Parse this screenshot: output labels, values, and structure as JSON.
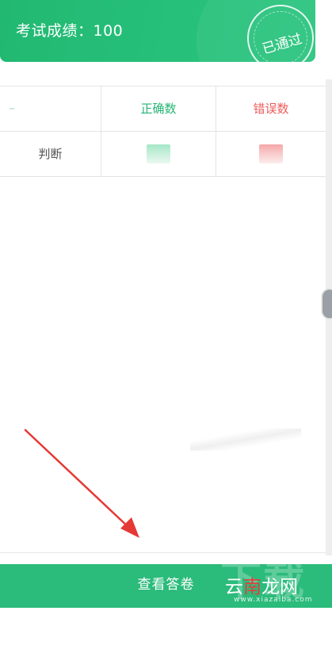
{
  "banner": {
    "score_text": "考试成绩：100",
    "stamp_text": "已通过"
  },
  "table": {
    "headers": [
      "",
      "正确数",
      "错误数"
    ],
    "rows": [
      {
        "type": "判断"
      }
    ]
  },
  "bottom": {
    "button_label": "查看答卷"
  },
  "watermark": {
    "big": "下载吧",
    "site_a": "云",
    "site_b": "南",
    "site_c": "龙网",
    "url": "www.xiazaiba.com"
  },
  "colors": {
    "accent": "#2bbb7b",
    "correct": "#25b574",
    "wrong": "#ef5b5b",
    "annotation_arrow": "#e53935"
  }
}
